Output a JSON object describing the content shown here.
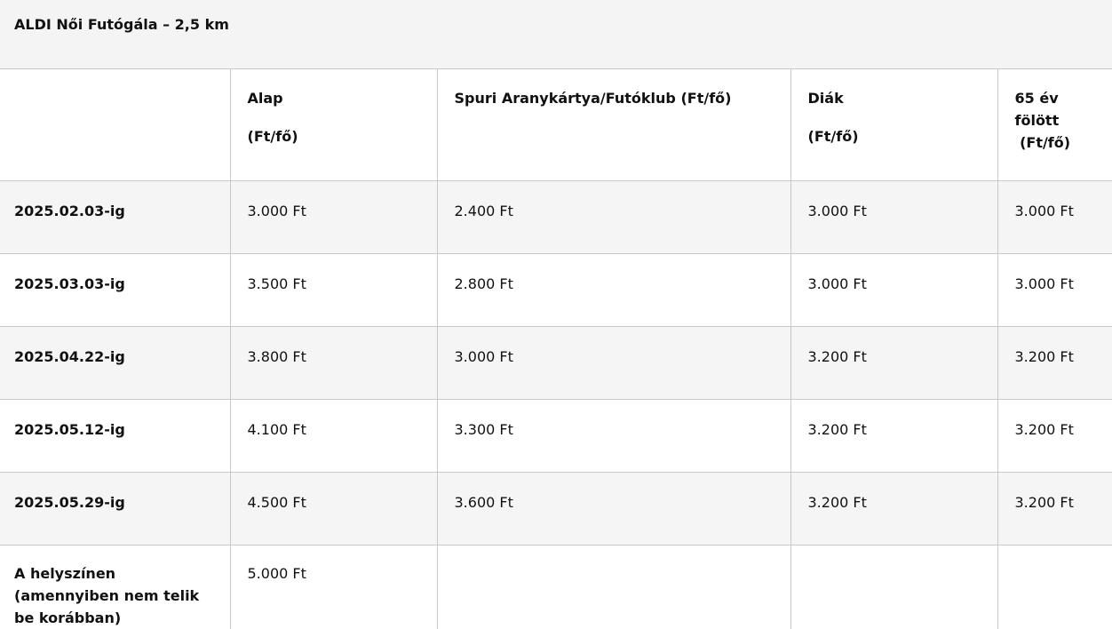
{
  "title": "ALDI Női Futógála – 2,5 km",
  "columns": [
    {
      "name": "Alap",
      "unit": "(Ft/fő)"
    },
    {
      "name": "Spuri Aranykártya/Futóklub (Ft/fő)",
      "unit": ""
    },
    {
      "name": "Diák",
      "unit": "(Ft/fő)"
    },
    {
      "name": "65 év fölött",
      "unit": " (Ft/fő)"
    }
  ],
  "rows": [
    {
      "label": "2025.02.03-ig",
      "values": [
        "3.000 Ft",
        "2.400 Ft",
        "3.000 Ft",
        "3.000 Ft"
      ]
    },
    {
      "label": "2025.03.03-ig",
      "values": [
        "3.500 Ft",
        "2.800 Ft",
        "3.000 Ft",
        "3.000 Ft"
      ]
    },
    {
      "label": "2025.04.22-ig",
      "values": [
        "3.800 Ft",
        "3.000 Ft",
        "3.200 Ft",
        "3.200 Ft"
      ]
    },
    {
      "label": "2025.05.12-ig",
      "values": [
        "4.100 Ft",
        "3.300 Ft",
        "3.200 Ft",
        "3.200 Ft"
      ]
    },
    {
      "label": "2025.05.29-ig",
      "values": [
        "4.500 Ft",
        "3.600 Ft",
        "3.200 Ft",
        "3.200 Ft"
      ]
    },
    {
      "label": "A helyszínen (amennyiben nem telik be korábban)",
      "values": [
        "5.000 Ft",
        "",
        "",
        ""
      ]
    }
  ]
}
